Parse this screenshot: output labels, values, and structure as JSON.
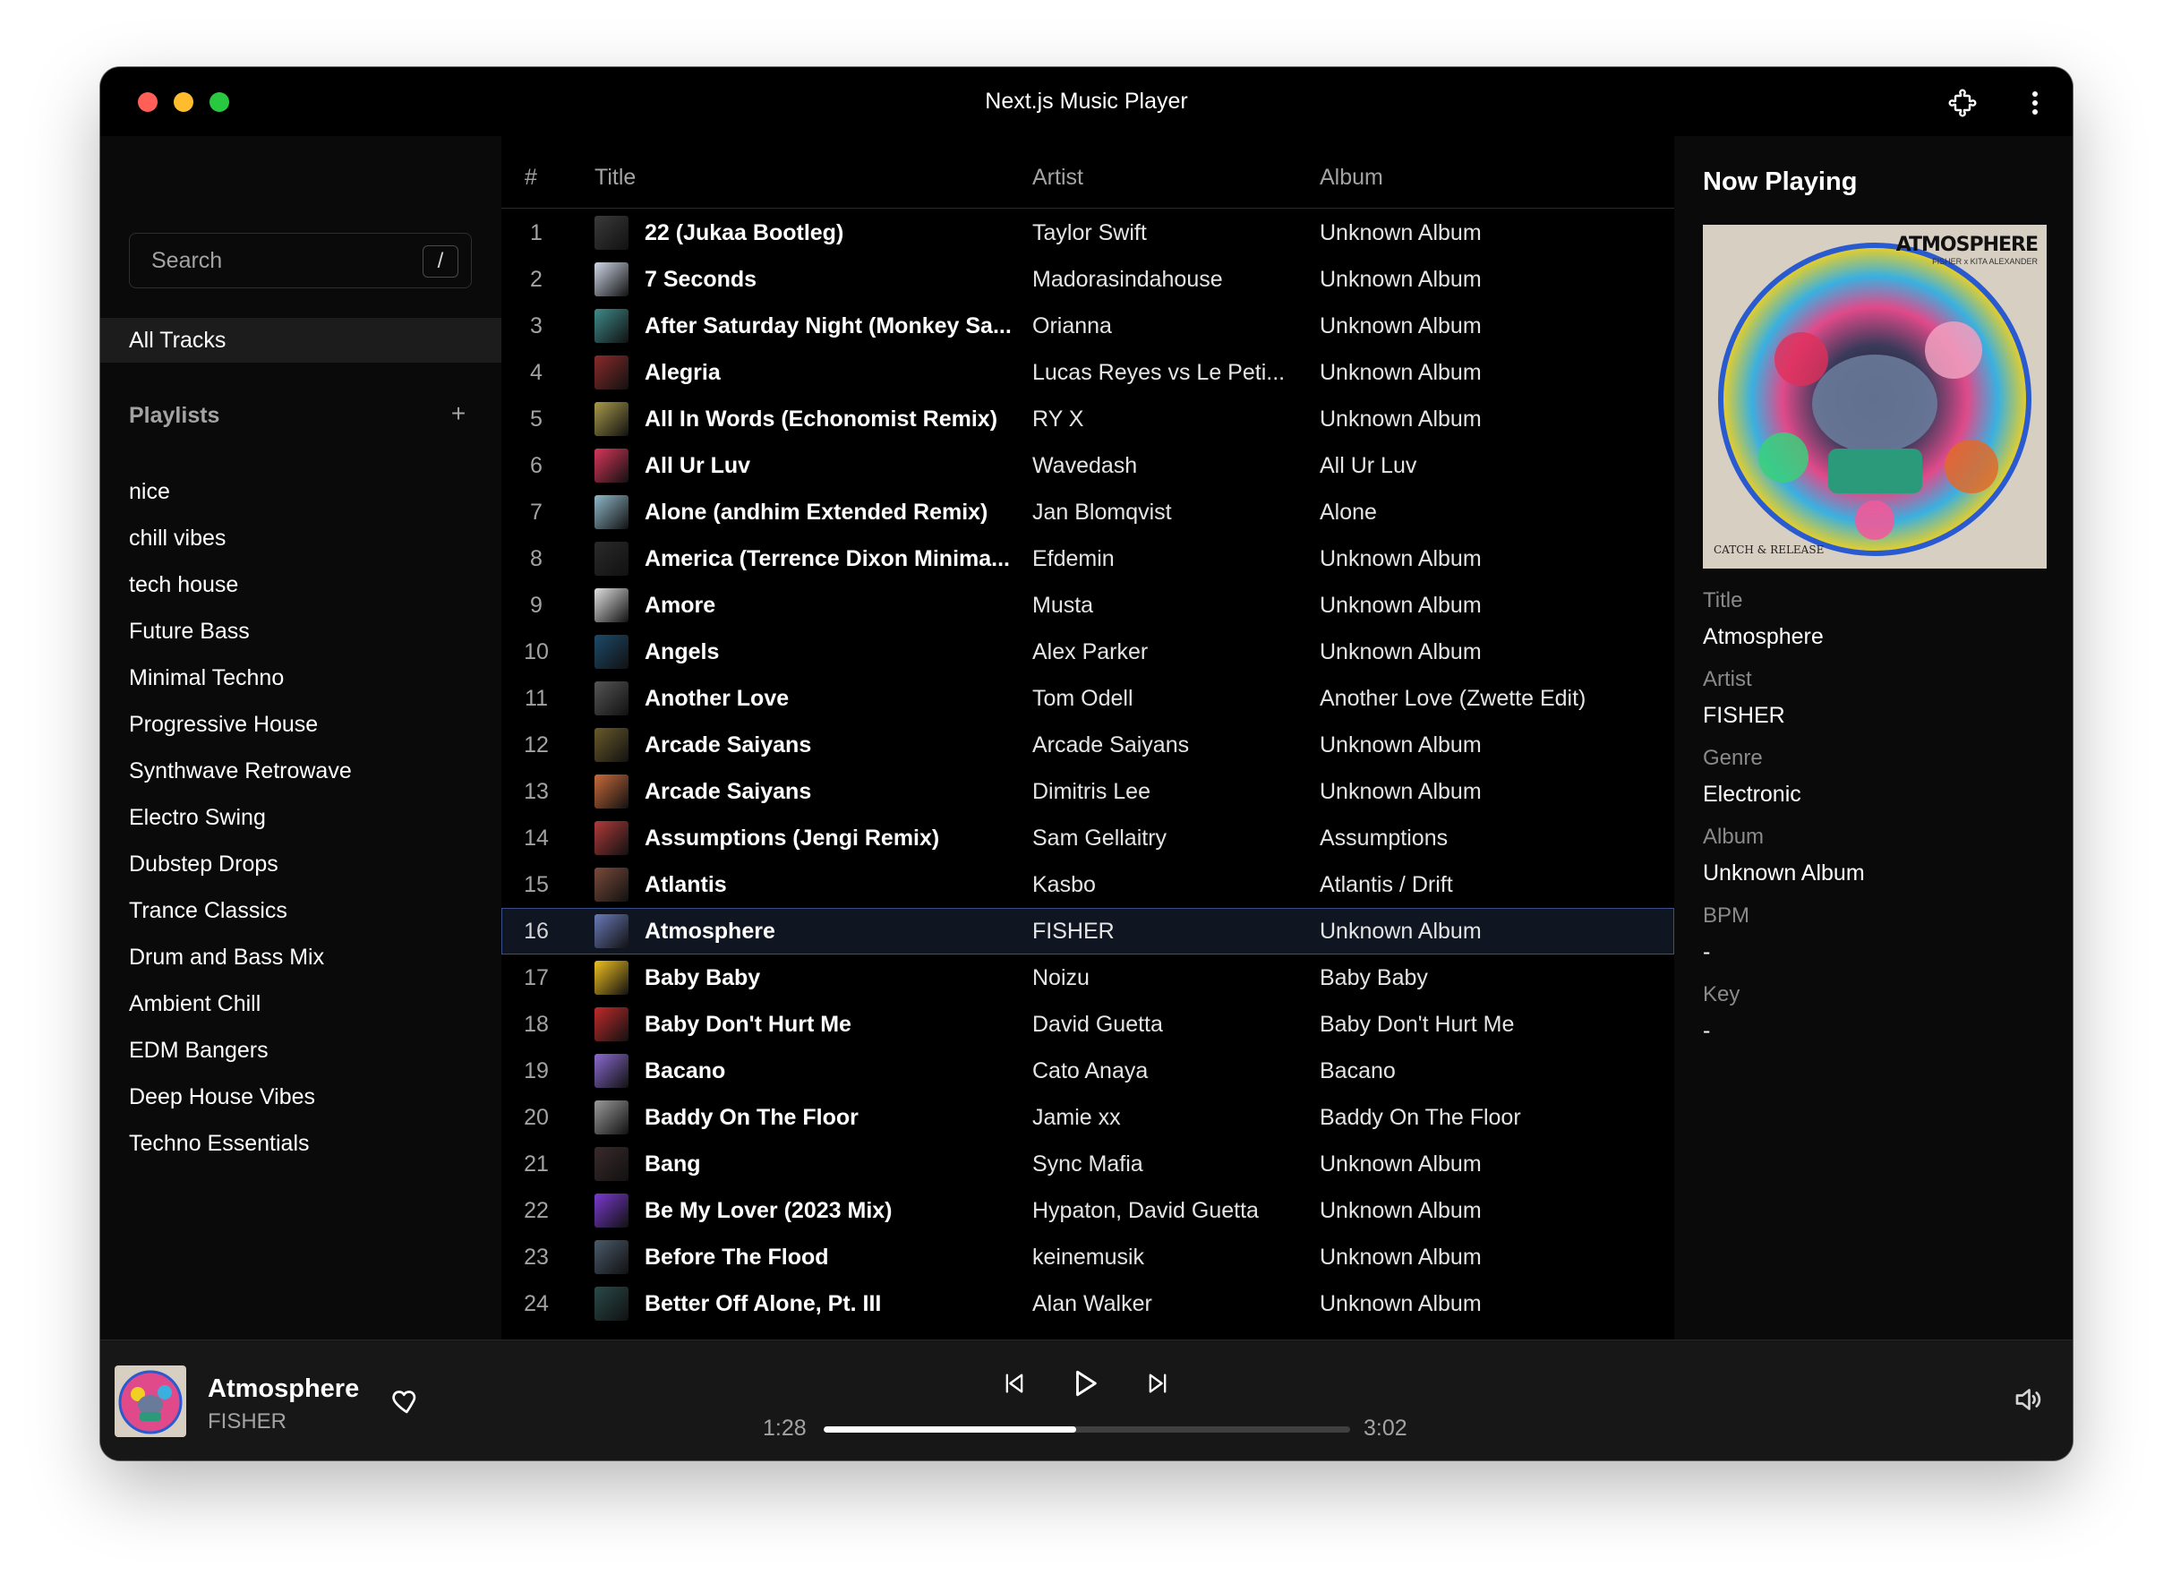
{
  "window": {
    "title": "Next.js Music Player"
  },
  "sidebar": {
    "search_placeholder": "Search",
    "search_shortcut": "/",
    "all_tracks_label": "All Tracks",
    "playlists_heading": "Playlists",
    "add_playlist_glyph": "+",
    "playlists": [
      "nice",
      "chill vibes",
      "tech house",
      "Future Bass",
      "Minimal Techno",
      "Progressive House",
      "Synthwave Retrowave",
      "Electro Swing",
      "Dubstep Drops",
      "Trance Classics",
      "Drum and Bass Mix",
      "Ambient Chill",
      "EDM Bangers",
      "Deep House Vibes",
      "Techno Essentials"
    ]
  },
  "table": {
    "headers": {
      "num": "#",
      "title": "Title",
      "artist": "Artist",
      "album": "Album"
    },
    "selected_index": 16,
    "rows": [
      {
        "num": "1",
        "title": "22 (Jukaa Bootleg)",
        "artist": "Taylor Swift",
        "album": "Unknown Album",
        "art_color": "#3a3a3a"
      },
      {
        "num": "2",
        "title": "7 Seconds",
        "artist": "Madorasindahouse",
        "album": "Unknown Album",
        "art_color": "#cfd6e6"
      },
      {
        "num": "3",
        "title": "After Saturday Night (Monkey Sa...",
        "artist": "Orianna",
        "album": "Unknown Album",
        "art_color": "#3f8a8a"
      },
      {
        "num": "4",
        "title": "Alegria",
        "artist": "Lucas Reyes vs Le Peti...",
        "album": "Unknown Album",
        "art_color": "#8a2a2a"
      },
      {
        "num": "5",
        "title": "All In Words (Echonomist Remix)",
        "artist": "RY X",
        "album": "Unknown Album",
        "art_color": "#a89a4a"
      },
      {
        "num": "6",
        "title": "All Ur Luv",
        "artist": "Wavedash",
        "album": "All Ur Luv",
        "art_color": "#d9365a"
      },
      {
        "num": "7",
        "title": "Alone (andhim Extended Remix)",
        "artist": "Jan Blomqvist",
        "album": "Alone",
        "art_color": "#8fb8c8"
      },
      {
        "num": "8",
        "title": "America (Terrence Dixon Minima...",
        "artist": "Efdemin",
        "album": "Unknown Album",
        "art_color": "#2a2a2a"
      },
      {
        "num": "9",
        "title": "Amore",
        "artist": "Musta",
        "album": "Unknown Album",
        "art_color": "#e0e0e0"
      },
      {
        "num": "10",
        "title": "Angels",
        "artist": "Alex Parker",
        "album": "Unknown Album",
        "art_color": "#1d4a6a"
      },
      {
        "num": "11",
        "title": "Another Love",
        "artist": "Tom Odell",
        "album": "Another Love (Zwette Edit)",
        "art_color": "#555555"
      },
      {
        "num": "12",
        "title": "Arcade Saiyans",
        "artist": "Arcade Saiyans",
        "album": "Unknown Album",
        "art_color": "#6a5a2a"
      },
      {
        "num": "13",
        "title": "Arcade Saiyans",
        "artist": "Dimitris Lee",
        "album": "Unknown Album",
        "art_color": "#c86a3a"
      },
      {
        "num": "14",
        "title": "Assumptions (Jengi Remix)",
        "artist": "Sam Gellaitry",
        "album": "Assumptions",
        "art_color": "#b03a3a"
      },
      {
        "num": "15",
        "title": "Atlantis",
        "artist": "Kasbo",
        "album": "Atlantis / Drift",
        "art_color": "#7a4a3a"
      },
      {
        "num": "16",
        "title": "Atmosphere",
        "artist": "FISHER",
        "album": "Unknown Album",
        "art_color": "#6a7ab8"
      },
      {
        "num": "17",
        "title": "Baby Baby",
        "artist": "Noizu",
        "album": "Baby Baby",
        "art_color": "#f0c020"
      },
      {
        "num": "18",
        "title": "Baby Don't Hurt Me",
        "artist": "David Guetta",
        "album": "Baby Don't Hurt Me",
        "art_color": "#c02a2a"
      },
      {
        "num": "19",
        "title": "Bacano",
        "artist": "Cato Anaya",
        "album": "Bacano",
        "art_color": "#8a6ad0"
      },
      {
        "num": "20",
        "title": "Baddy On The Floor",
        "artist": "Jamie xx",
        "album": "Baddy On The Floor",
        "art_color": "#9a9a9a"
      },
      {
        "num": "21",
        "title": "Bang",
        "artist": "Sync Mafia",
        "album": "Unknown Album",
        "art_color": "#3a2a2a"
      },
      {
        "num": "22",
        "title": "Be My Lover (2023 Mix)",
        "artist": "Hypaton, David Guetta",
        "album": "Unknown Album",
        "art_color": "#7a3ad0"
      },
      {
        "num": "23",
        "title": "Before The Flood",
        "artist": "keinemusik",
        "album": "Unknown Album",
        "art_color": "#4a5a6a"
      },
      {
        "num": "24",
        "title": "Better Off Alone, Pt. III",
        "artist": "Alan Walker",
        "album": "Unknown Album",
        "art_color": "#2a4a4a"
      }
    ]
  },
  "now_playing": {
    "heading": "Now Playing",
    "art_text": "ATMOSPHERE",
    "art_subtext": "FISHER x KITA ALEXANDER",
    "art_label": "CATCH & RELEASE",
    "title_label": "Title",
    "title": "Atmosphere",
    "artist_label": "Artist",
    "artist": "FISHER",
    "genre_label": "Genre",
    "genre": "Electronic",
    "album_label": "Album",
    "album": "Unknown Album",
    "bpm_label": "BPM",
    "bpm": "-",
    "key_label": "Key",
    "key": "-"
  },
  "player": {
    "title": "Atmosphere",
    "artist": "FISHER",
    "current_time": "1:28",
    "total_time": "3:02",
    "progress_fraction": 0.48
  }
}
